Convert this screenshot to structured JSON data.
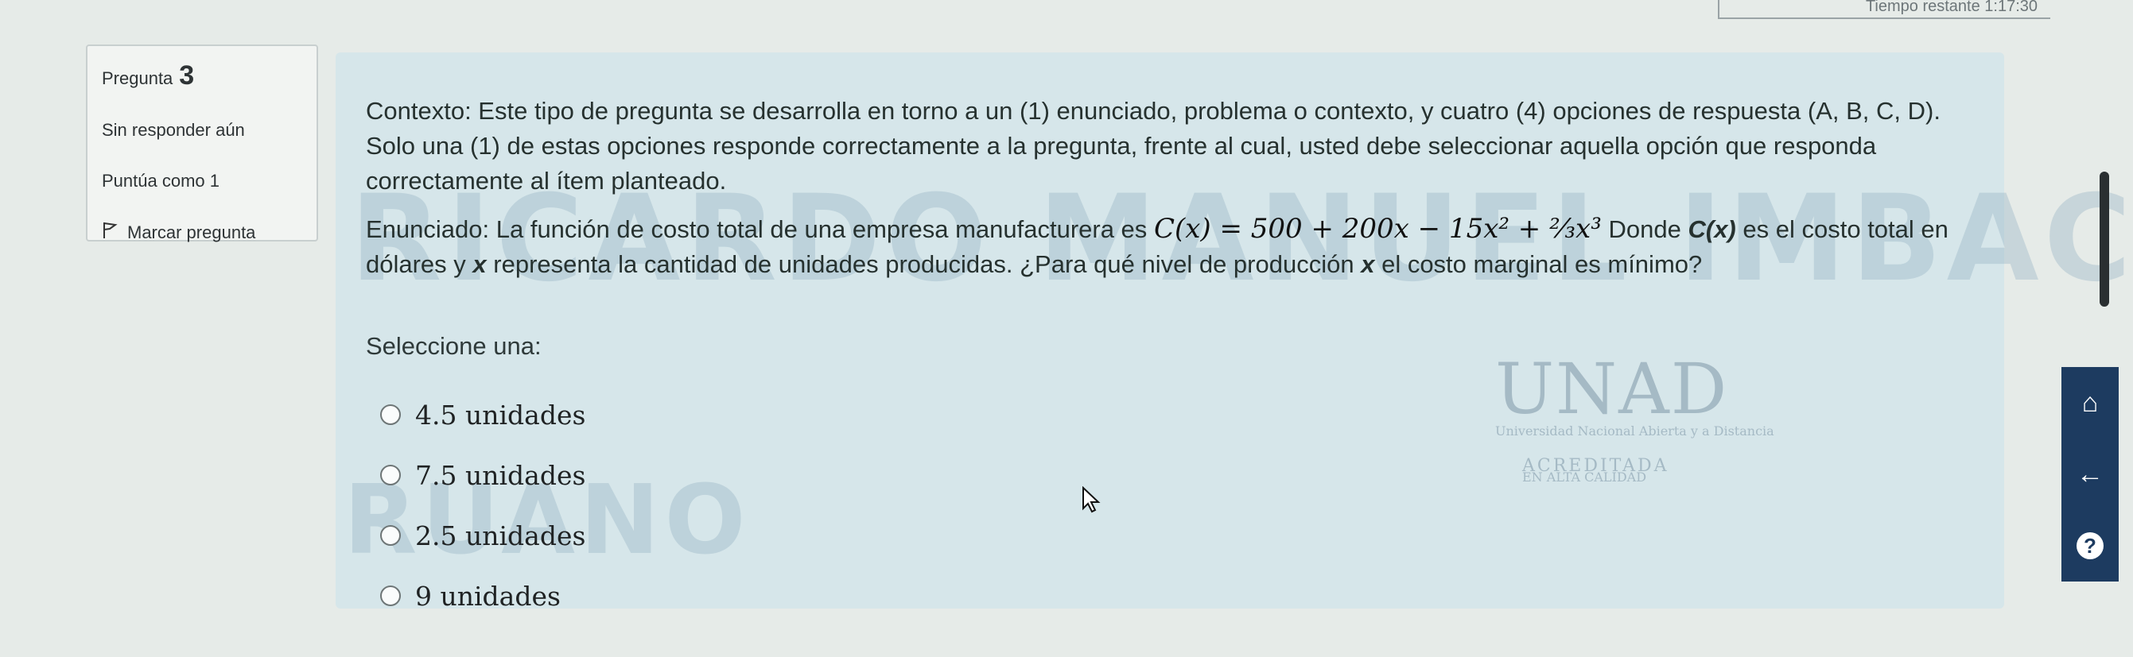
{
  "timer": {
    "text": "Tiempo restante 1:17:30"
  },
  "question_info": {
    "label": "Pregunta",
    "number": "3",
    "status": "Sin responder aún",
    "score": "Puntúa como 1",
    "flag_label": "Marcar pregunta"
  },
  "question": {
    "context": "Contexto: Este tipo de pregunta se desarrolla en torno a un (1) enunciado, problema o contexto, y cuatro (4) opciones de respuesta (A, B, C, D). Solo una (1) de estas opciones responde correctamente a la pregunta, frente al cual, usted debe seleccionar aquella opción que responda correctamente al ítem planteado.",
    "statement_prefix": "Enunciado: La función de costo total de una empresa manufacturera es",
    "formula": "C(x) = 500 + 200x − 15x² + ⅔x³",
    "statement_mid": "Donde",
    "cx": "C(x)",
    "statement_suffix_1": "es el costo total en dólares y",
    "x_var": "x",
    "statement_suffix_2": "representa la cantidad de unidades producidas. ¿Para qué nivel de producción",
    "statement_suffix_3": "el costo marginal es mínimo?",
    "prompt": "Seleccione una:",
    "options": [
      "4.5 unidades",
      "7.5 unidades",
      "2.5 unidades",
      "9 unidades"
    ]
  },
  "watermark": {
    "line1": "RICARDO MANUEL IMBACUAN",
    "line2": "RUANO"
  },
  "logo": {
    "name": "UNAD",
    "subtitle": "Universidad Nacional Abierta y a Distancia",
    "accredited": "ACREDITADA",
    "accredited_sub": "EN ALTA CALIDAD"
  },
  "side_dock": {
    "icons": [
      "home-icon",
      "back-arrow-icon",
      "help-icon"
    ]
  }
}
